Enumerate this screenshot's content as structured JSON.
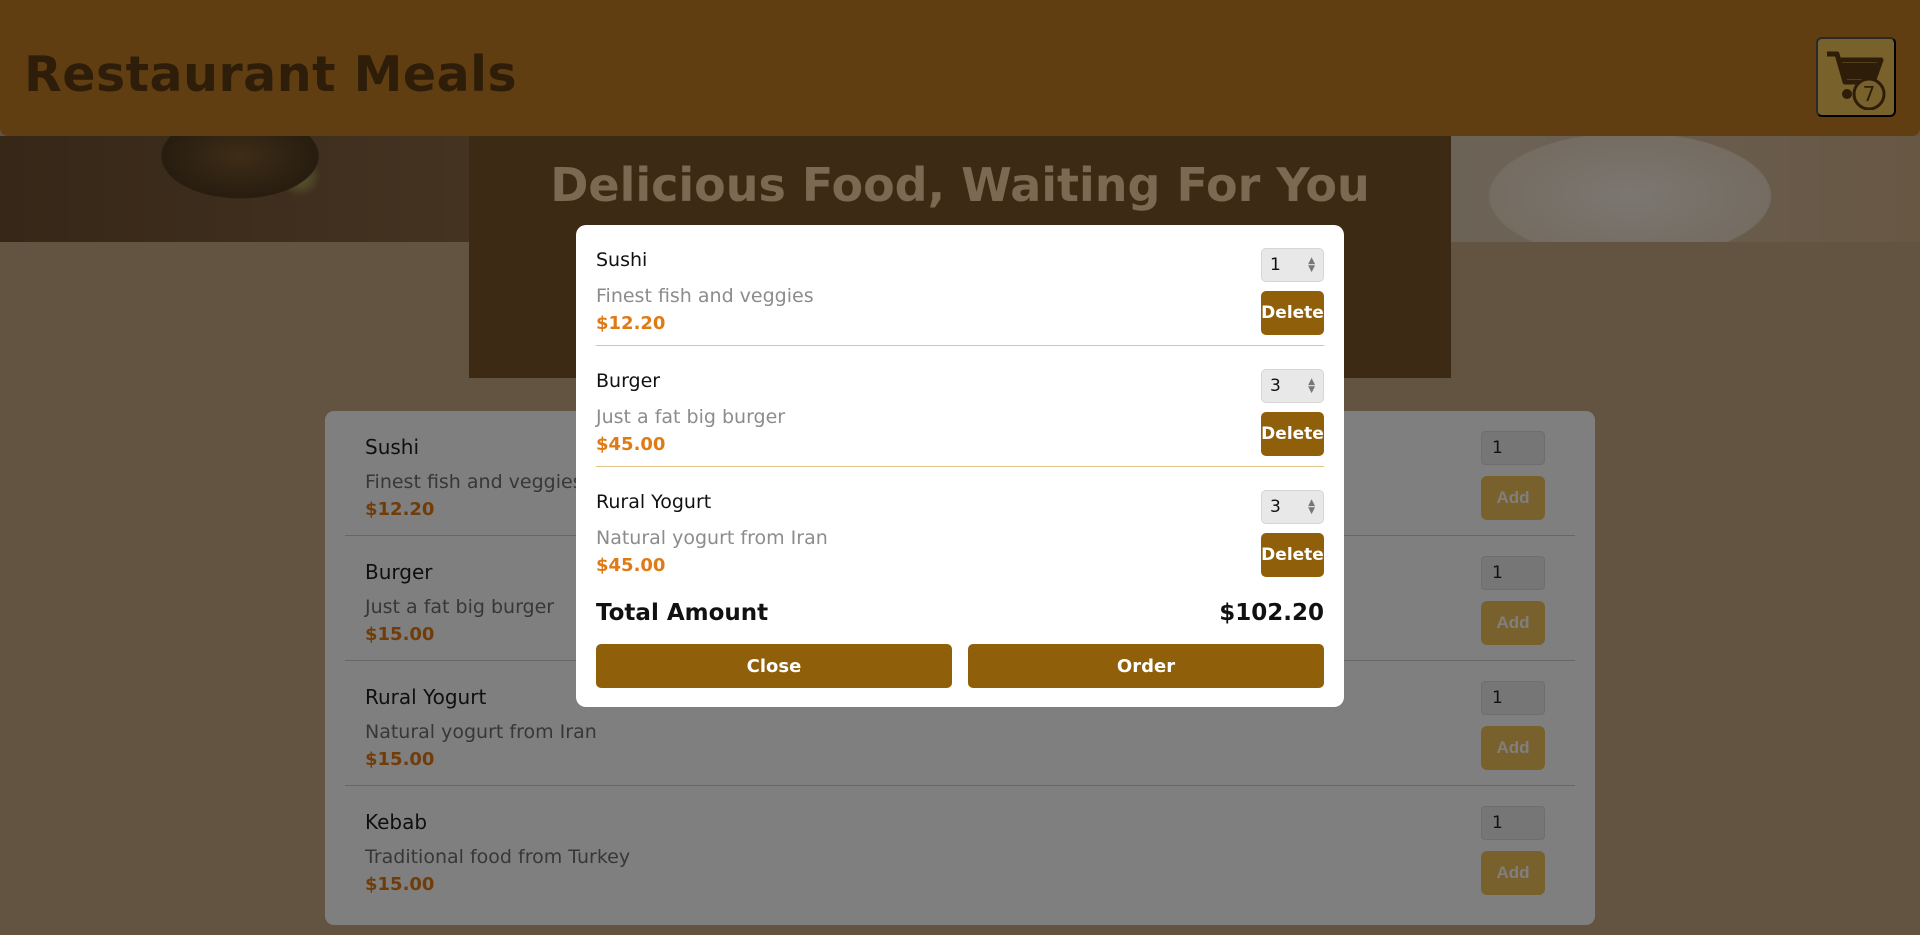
{
  "header": {
    "title": "Restaurant Meals",
    "cart_count": "7",
    "cart_icon": "shopping-cart-icon"
  },
  "hero": {
    "heading": "Delicious Food, Waiting For You"
  },
  "menu": {
    "add_label": "Add",
    "items": [
      {
        "name": "Sushi",
        "description": "Finest fish and veggies",
        "price": "$12.20",
        "qty": "1"
      },
      {
        "name": "Burger",
        "description": "Just a fat big burger",
        "price": "$15.00",
        "qty": "1"
      },
      {
        "name": "Rural Yogurt",
        "description": "Natural yogurt from Iran",
        "price": "$15.00",
        "qty": "1"
      },
      {
        "name": "Kebab",
        "description": "Traditional food from Turkey",
        "price": "$15.00",
        "qty": "1"
      }
    ]
  },
  "cart_modal": {
    "delete_label": "Delete",
    "items": [
      {
        "name": "Sushi",
        "description": "Finest fish and veggies",
        "price": "$12.20",
        "qty": "1"
      },
      {
        "name": "Burger",
        "description": "Just a fat big burger",
        "price": "$45.00",
        "qty": "3"
      },
      {
        "name": "Rural Yogurt",
        "description": "Natural yogurt from Iran",
        "price": "$45.00",
        "qty": "3"
      }
    ],
    "total_label": "Total Amount",
    "total_value": "$102.20",
    "close_label": "Close",
    "order_label": "Order"
  },
  "colors": {
    "header_bg": "#c27c24",
    "accent_button": "#8f5f0a",
    "price": "#e07a15"
  }
}
